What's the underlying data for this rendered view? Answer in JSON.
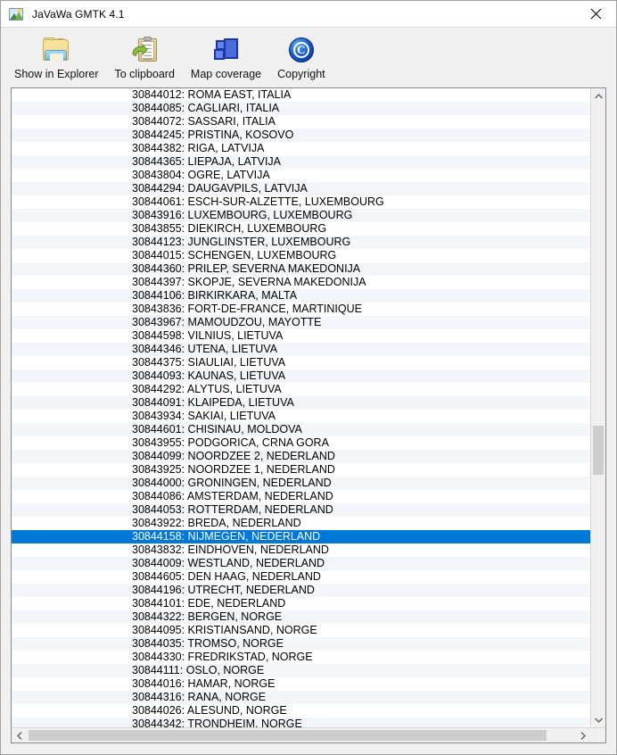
{
  "window": {
    "title": "JaVaWa GMTK 4.1",
    "app_icon": "map-app-icon",
    "close_label": "✕"
  },
  "toolbar": {
    "buttons": [
      {
        "label": "Show in Explorer",
        "icon": "folder-icon"
      },
      {
        "label": "To clipboard",
        "icon": "clipboard-copy-icon"
      },
      {
        "label": "Map coverage",
        "icon": "map-layers-icon"
      },
      {
        "label": "Copyright",
        "icon": "copyright-icon"
      }
    ]
  },
  "colors": {
    "selection": "#0078d7",
    "row_alt": "#f2f5f9",
    "window_bg": "#f0f0f0",
    "scrollbar_thumb": "#cdcdcd"
  },
  "list": {
    "selected_index": 33,
    "items": [
      "30844012: ROMA EAST, ITALIA",
      "30844085: CAGLIARI, ITALIA",
      "30844072: SASSARI, ITALIA",
      "30844245: PRISTINA, KOSOVO",
      "30844382: RIGA, LATVIJA",
      "30844365: LIEPAJA, LATVIJA",
      "30843804: OGRE, LATVIJA",
      "30844294: DAUGAVPILS, LATVIJA",
      "30844061: ESCH-SUR-ALZETTE, LUXEMBOURG",
      "30843916: LUXEMBOURG, LUXEMBOURG",
      "30843855: DIEKIRCH, LUXEMBOURG",
      "30844123: JUNGLINSTER, LUXEMBOURG",
      "30844015: SCHENGEN, LUXEMBOURG",
      "30844360: PRILEP, SEVERNA MAKEDONIJA",
      "30844397: SKOPJE, SEVERNA MAKEDONIJA",
      "30844106: BIRKIRKARA, MALTA",
      "30843836: FORT-DE-FRANCE, MARTINIQUE",
      "30843967: MAMOUDZOU, MAYOTTE",
      "30844598: VILNIUS, LIETUVA",
      "30844346: UTENA, LIETUVA",
      "30844375: SIAULIAI, LIETUVA",
      "30844093: KAUNAS, LIETUVA",
      "30844292: ALYTUS, LIETUVA",
      "30844091: KLAIPEDA, LIETUVA",
      "30843934: SAKIAI, LIETUVA",
      "30844601: CHISINAU, MOLDOVA",
      "30843955: PODGORICA, CRNA GORA",
      "30844099: NOORDZEE 2, NEDERLAND",
      "30843925: NOORDZEE 1, NEDERLAND",
      "30844000: GRONINGEN, NEDERLAND",
      "30844086: AMSTERDAM, NEDERLAND",
      "30844053: ROTTERDAM, NEDERLAND",
      "30843922: BREDA, NEDERLAND",
      "30844158: NIJMEGEN, NEDERLAND",
      "30843832: EINDHOVEN, NEDERLAND",
      "30844009: WESTLAND, NEDERLAND",
      "30844605: DEN HAAG, NEDERLAND",
      "30844196: UTRECHT, NEDERLAND",
      "30844101: EDE, NEDERLAND",
      "30844322: BERGEN, NORGE",
      "30844095: KRISTIANSAND, NORGE",
      "30844035: TROMSO, NORGE",
      "30844330: FREDRIKSTAD, NORGE",
      "30844111: OSLO, NORGE",
      "30844016: HAMAR, NORGE",
      "30844316: RANA, NORGE",
      "30844026: ALESUND, NORGE",
      "30844342: TRONDHEIM, NORGE"
    ]
  },
  "scrollbars": {
    "vertical": {
      "up_arrow": "▲",
      "down_arrow": "▼"
    },
    "horizontal": {
      "left_arrow": "◀",
      "right_arrow": "▶"
    }
  }
}
